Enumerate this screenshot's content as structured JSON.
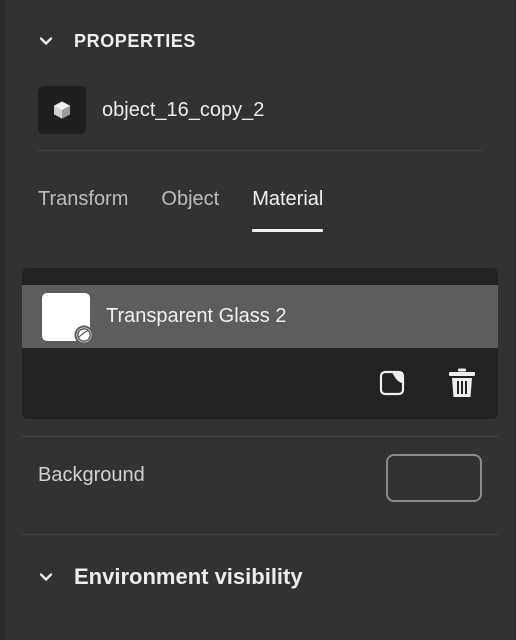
{
  "properties": {
    "title": "PROPERTIES",
    "chevron_icon": "chevron-down-icon"
  },
  "object": {
    "icon": "cube-icon",
    "name": "object_16_copy_2"
  },
  "tabs": [
    {
      "label": "Transform",
      "active": false
    },
    {
      "label": "Object",
      "active": false
    },
    {
      "label": "Material",
      "active": true
    }
  ],
  "material": {
    "name": "Transparent Glass 2",
    "swatch_color": "#ffffff",
    "actions": [
      {
        "icon": "edit-material-icon"
      },
      {
        "icon": "trash-icon"
      }
    ]
  },
  "background": {
    "label": "Background",
    "color": "#323232"
  },
  "environment": {
    "title": "Environment visibility",
    "chevron_icon": "chevron-down-icon"
  },
  "colors": {
    "panel_bg": "#323232",
    "card_bg": "#222222",
    "selected_row": "#5d5d5d",
    "text": "#e6e6e6"
  }
}
